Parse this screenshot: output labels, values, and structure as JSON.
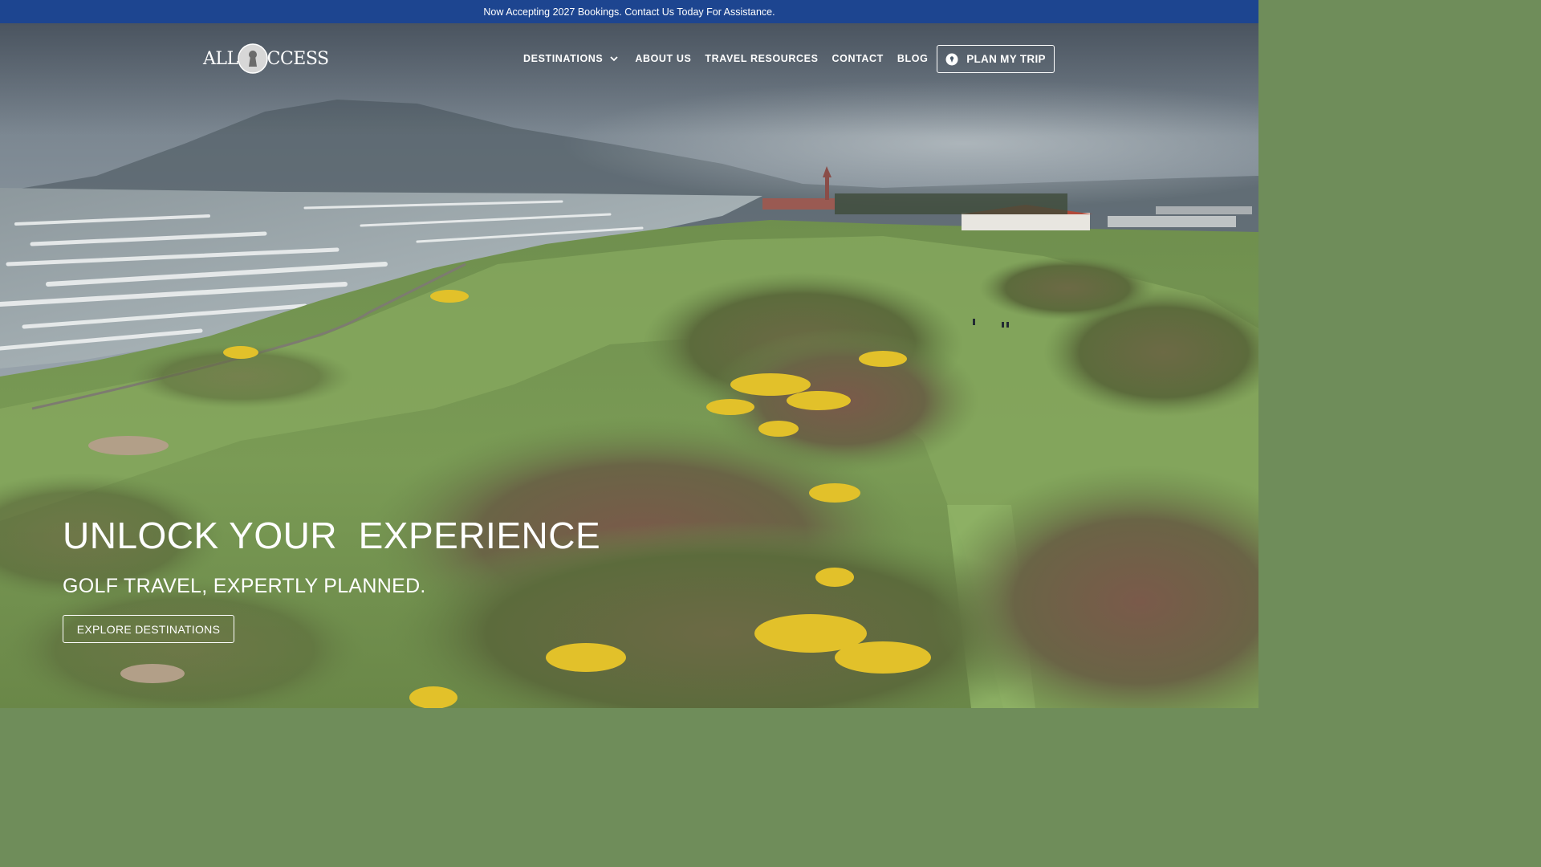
{
  "announcement": "Now Accepting 2027 Bookings. Contact Us Today For Assistance.",
  "logo": {
    "text_left": "ALL",
    "text_right": "CCESS"
  },
  "nav": {
    "items": [
      {
        "label": "DESTINATIONS",
        "has_dropdown": true
      },
      {
        "label": "ABOUT US"
      },
      {
        "label": "TRAVEL RESOURCES"
      },
      {
        "label": "CONTACT"
      },
      {
        "label": "BLOG"
      }
    ],
    "cta_label": "PLAN MY TRIP",
    "cta_icon": "location-pin-icon"
  },
  "hero": {
    "title": "UNLOCK YOUR  EXPERIENCE",
    "subtitle": "GOLF TRAVEL, EXPERTLY PLANNED.",
    "button_label": "EXPLORE DESTINATIONS",
    "background": "aerial view of a coastal links golf course with gorse, dunes and beach"
  },
  "colors": {
    "announcement_bg": "#1d4590",
    "text": "#ffffff",
    "fairway": "#7fa35a",
    "gorse": "#e4c22a",
    "sea": "#c9d2d6",
    "sky": "#8a96a0"
  }
}
